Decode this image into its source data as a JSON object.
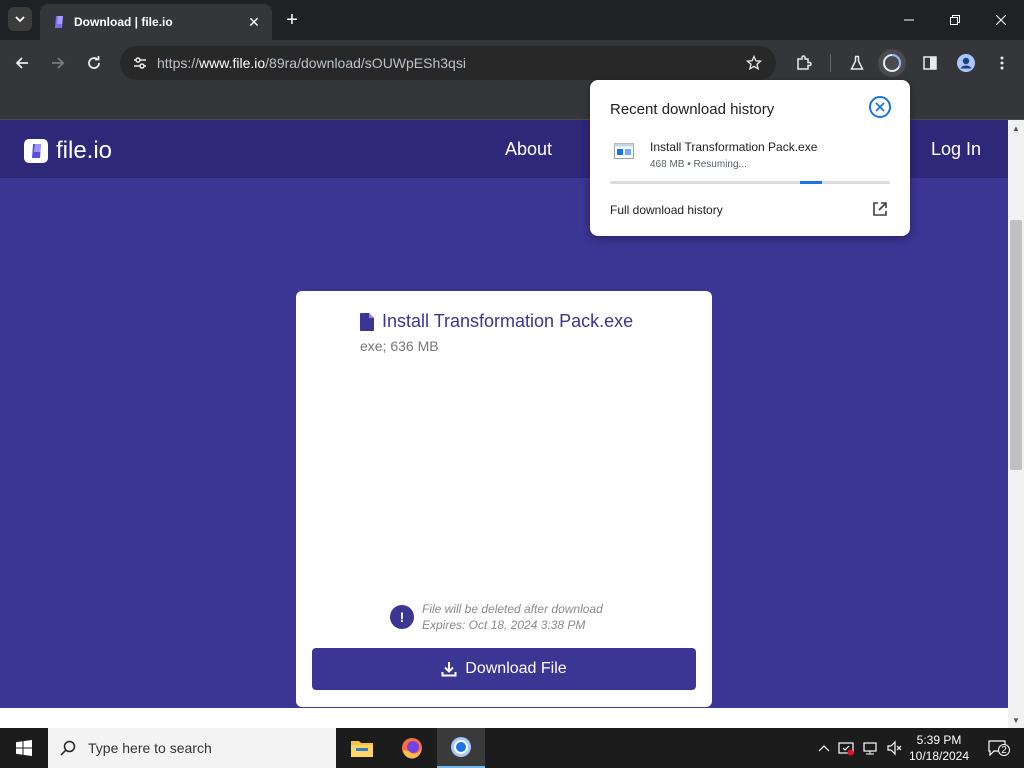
{
  "browser": {
    "tab": {
      "title": "Download | file.io"
    },
    "address": {
      "scheme": "https://",
      "host": "www.file.io",
      "path": "/89ra/download/sOUWpESh3qsi"
    }
  },
  "site": {
    "logo_text": "file.io",
    "nav": {
      "about": "About",
      "login": "Log In"
    },
    "colors": {
      "brand": "#3b3593",
      "header": "#2d2877"
    }
  },
  "file_card": {
    "file_name": "Install Transformation Pack.exe",
    "file_meta": "exe; 636 MB",
    "notice_line1": "File will be deleted after download",
    "notice_line2": "Expires: Oct 18, 2024 3:38 PM",
    "notice_icon": "!",
    "download_button": "Download File"
  },
  "downloads_bubble": {
    "title": "Recent download history",
    "item": {
      "name": "Install Transformation Pack.exe",
      "status": "468 MB • Resuming...",
      "progress": 0.74
    },
    "full_history_link": "Full download history"
  },
  "taskbar": {
    "search_placeholder": "Type here to search",
    "time": "5:39 PM",
    "date": "10/18/2024",
    "notification_count": "2"
  }
}
